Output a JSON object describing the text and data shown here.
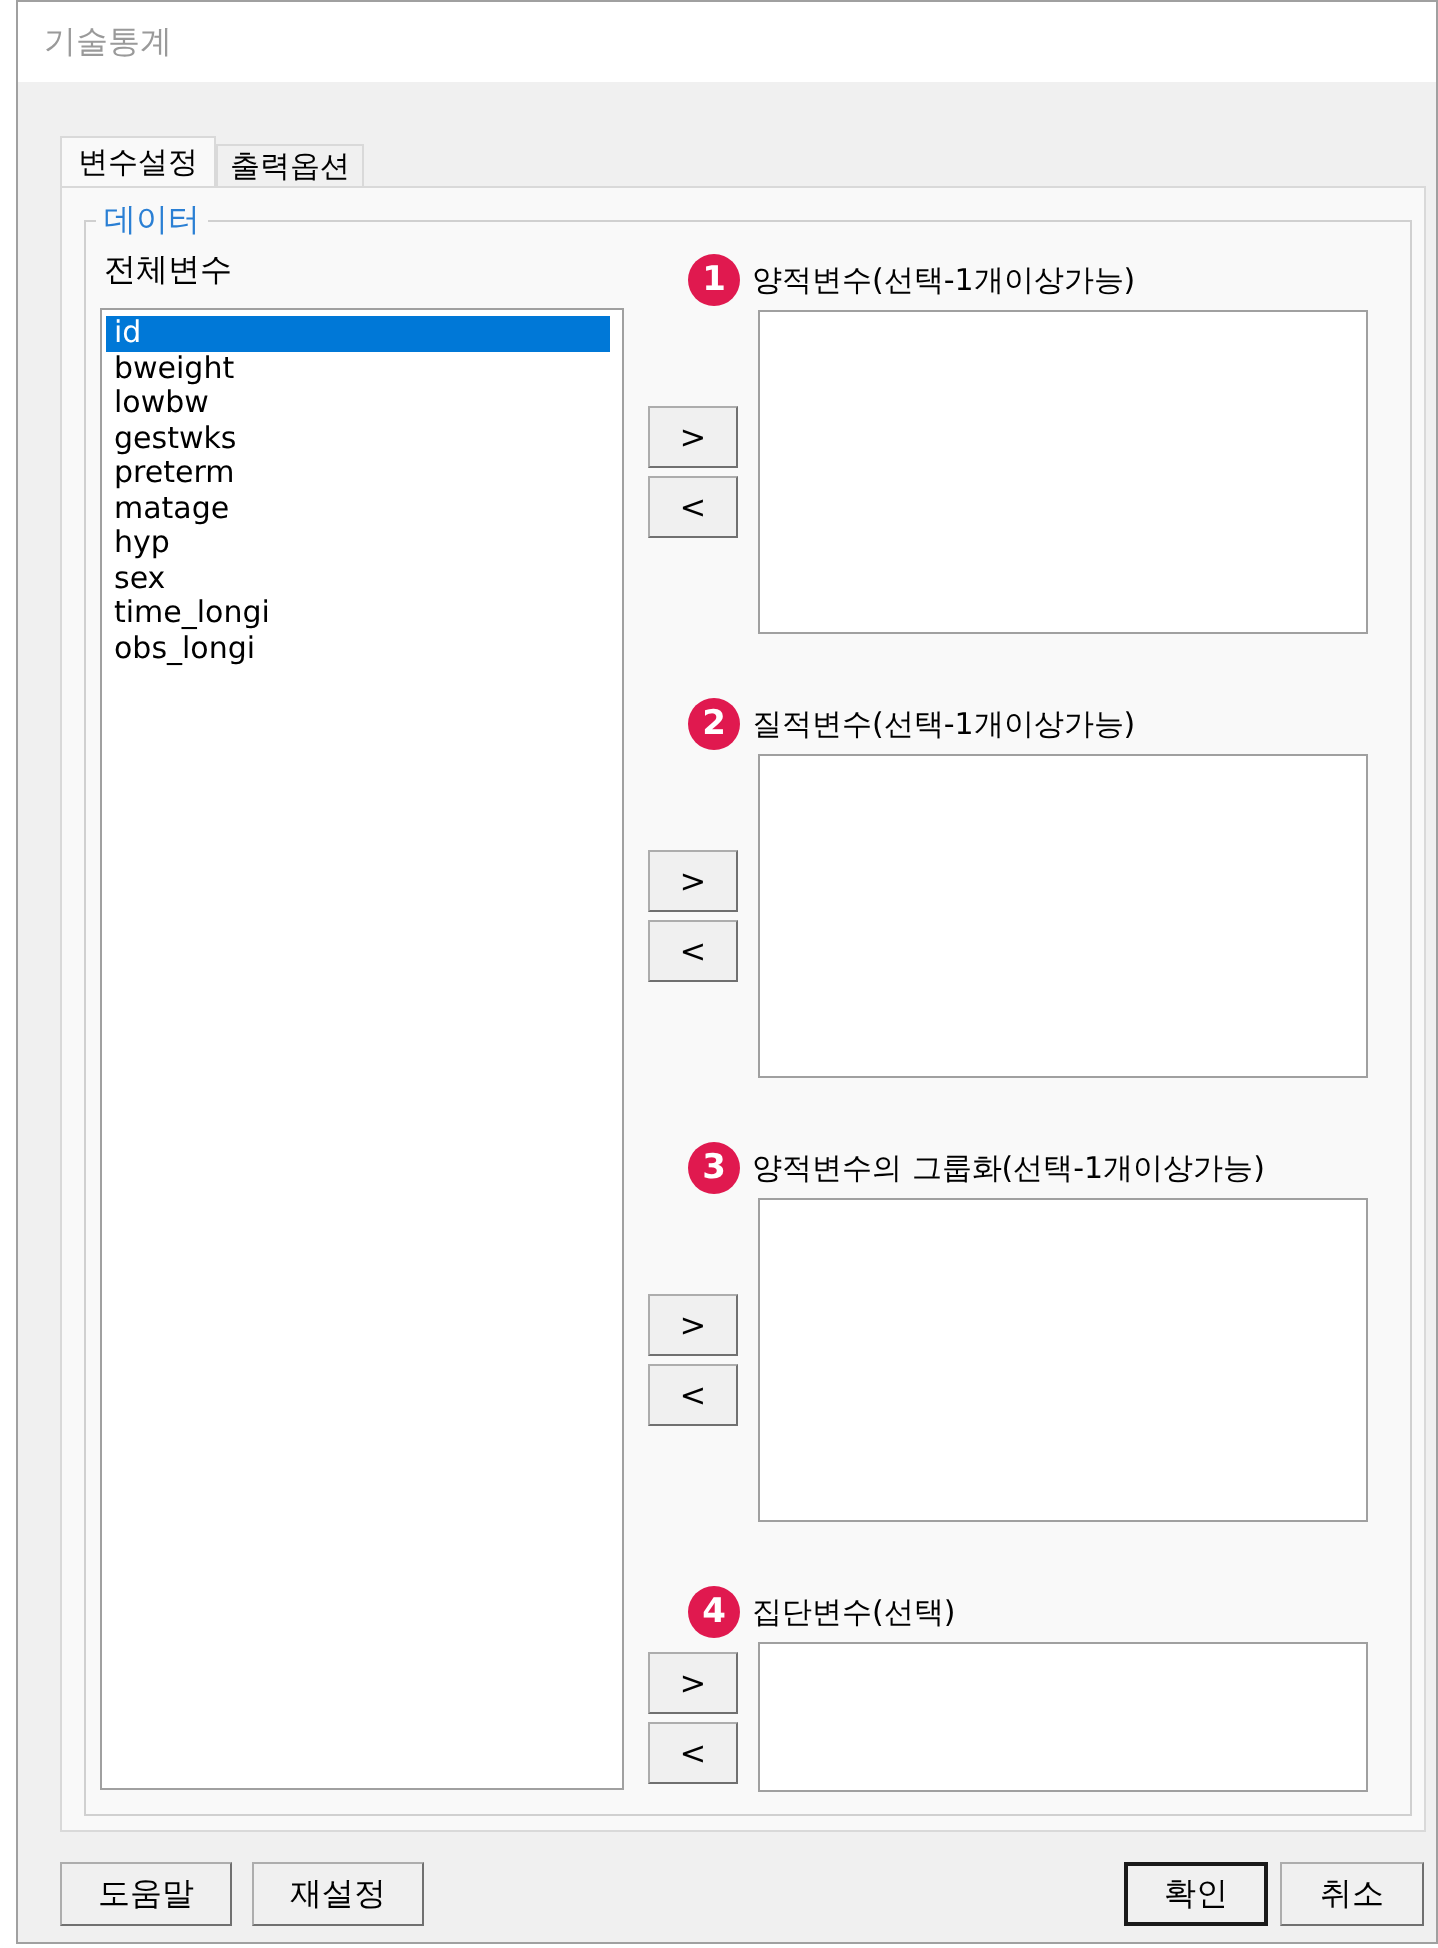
{
  "window": {
    "title": "기술통계"
  },
  "tabs": [
    {
      "label": "변수설정",
      "selected": true
    },
    {
      "label": "출력옵션",
      "selected": false
    }
  ],
  "group": {
    "title": "데이터"
  },
  "variables": {
    "label": "전체변수",
    "items": [
      {
        "name": "id",
        "selected": true
      },
      {
        "name": "bweight",
        "selected": false
      },
      {
        "name": "lowbw",
        "selected": false
      },
      {
        "name": "gestwks",
        "selected": false
      },
      {
        "name": "preterm",
        "selected": false
      },
      {
        "name": "matage",
        "selected": false
      },
      {
        "name": "hyp",
        "selected": false
      },
      {
        "name": "sex",
        "selected": false
      },
      {
        "name": "time_longi",
        "selected": false
      },
      {
        "name": "obs_longi",
        "selected": false
      }
    ]
  },
  "targets": [
    {
      "number": "1",
      "label": "양적변수(선택-1개이상가능)",
      "add": ">",
      "remove": "<"
    },
    {
      "number": "2",
      "label": "질적변수(선택-1개이상가능)",
      "add": ">",
      "remove": "<"
    },
    {
      "number": "3",
      "label": "양적변수의 그룹화(선택-1개이상가능)",
      "add": ">",
      "remove": "<"
    },
    {
      "number": "4",
      "label": "집단변수(선택)",
      "add": ">",
      "remove": "<"
    }
  ],
  "buttons_left": [
    {
      "label": "도움말",
      "default": false
    },
    {
      "label": "재설정",
      "default": false
    }
  ],
  "buttons_right": [
    {
      "label": "확인",
      "default": true
    },
    {
      "label": "취소",
      "default": false
    }
  ]
}
